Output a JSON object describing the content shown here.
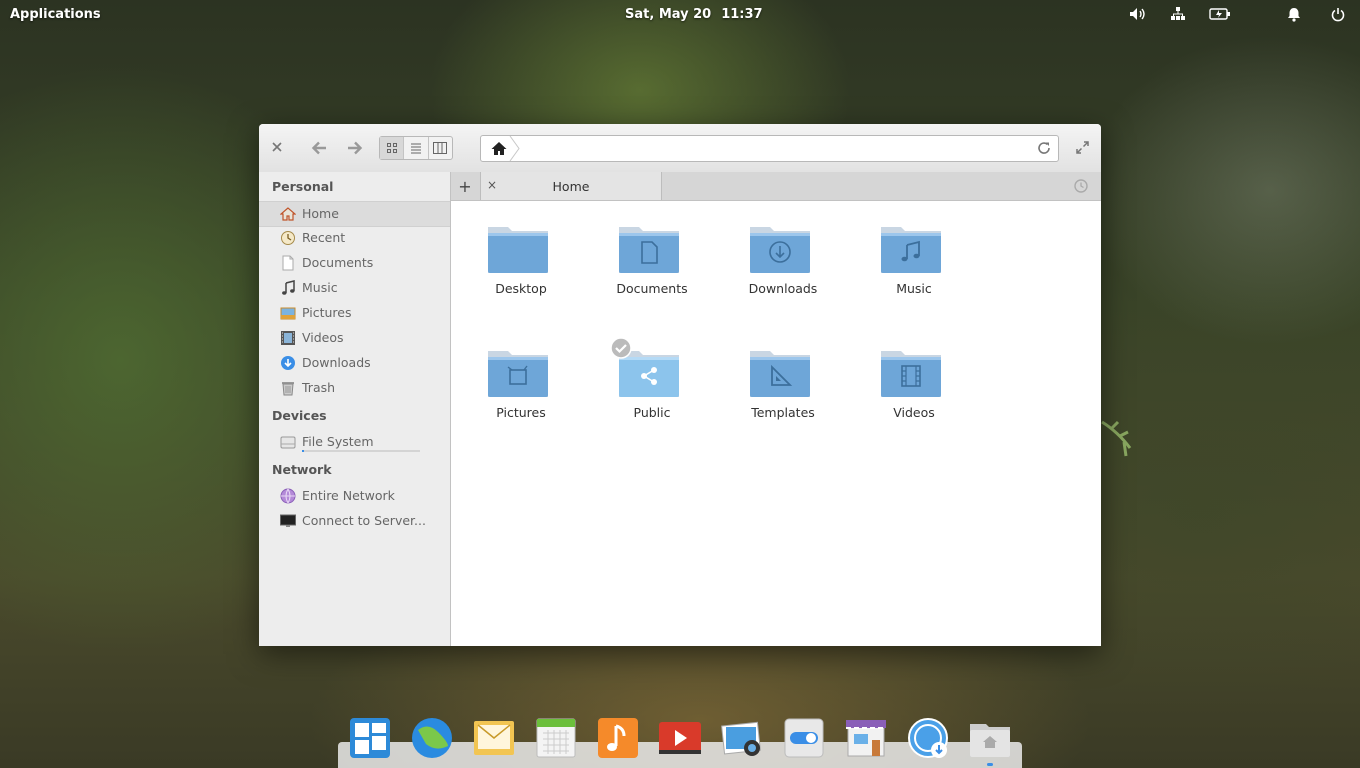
{
  "panel": {
    "applications_label": "Applications",
    "date": "Sat, May 20",
    "time": "11:37",
    "indicators": [
      "volume-icon",
      "network-icon",
      "battery-icon",
      "notifications-icon",
      "power-icon"
    ]
  },
  "window": {
    "toolbar": {
      "close_icon": "close-icon",
      "back_icon": "back-arrow-icon",
      "forward_icon": "forward-arrow-icon",
      "view_modes": [
        "icon-view",
        "list-view",
        "column-view"
      ],
      "active_view": "icon-view",
      "path_home_icon": "home-icon",
      "path_value": "",
      "reload_icon": "reload-icon",
      "maximize_icon": "maximize-icon"
    },
    "tabs": {
      "add_icon": "+",
      "close_icon": "×",
      "items": [
        {
          "label": "Home"
        }
      ]
    },
    "sidebar": {
      "sections": [
        {
          "title": "Personal",
          "items": [
            {
              "label": "Home",
              "icon": "home-icon",
              "selected": true
            },
            {
              "label": "Recent",
              "icon": "recent-icon"
            },
            {
              "label": "Documents",
              "icon": "document-icon"
            },
            {
              "label": "Music",
              "icon": "music-icon"
            },
            {
              "label": "Pictures",
              "icon": "pictures-icon"
            },
            {
              "label": "Videos",
              "icon": "videos-icon"
            },
            {
              "label": "Downloads",
              "icon": "downloads-icon"
            },
            {
              "label": "Trash",
              "icon": "trash-icon"
            }
          ]
        },
        {
          "title": "Devices",
          "items": [
            {
              "label": "File System",
              "icon": "drive-icon",
              "usage": 0.02
            }
          ]
        },
        {
          "title": "Network",
          "items": [
            {
              "label": "Entire Network",
              "icon": "network-globe-icon"
            },
            {
              "label": "Connect to Server...",
              "icon": "monitor-icon"
            }
          ]
        }
      ]
    },
    "folders": [
      {
        "name": "Desktop",
        "emblem": "none"
      },
      {
        "name": "Documents",
        "emblem": "document"
      },
      {
        "name": "Downloads",
        "emblem": "download"
      },
      {
        "name": "Music",
        "emblem": "music"
      },
      {
        "name": "Pictures",
        "emblem": "pictures"
      },
      {
        "name": "Public",
        "emblem": "share",
        "badge": "checkmark"
      },
      {
        "name": "Templates",
        "emblem": "templates"
      },
      {
        "name": "Videos",
        "emblem": "film"
      }
    ]
  },
  "dock": {
    "apps": [
      "multitasking-view-icon",
      "web-browser-icon",
      "mail-icon",
      "calendar-icon",
      "music-player-icon",
      "videos-player-icon",
      "photos-icon",
      "settings-icon",
      "app-center-icon",
      "updates-icon",
      "files-icon"
    ]
  },
  "colors": {
    "folder_blue": "#6ea6d8",
    "accent": "#3a8ee6"
  }
}
